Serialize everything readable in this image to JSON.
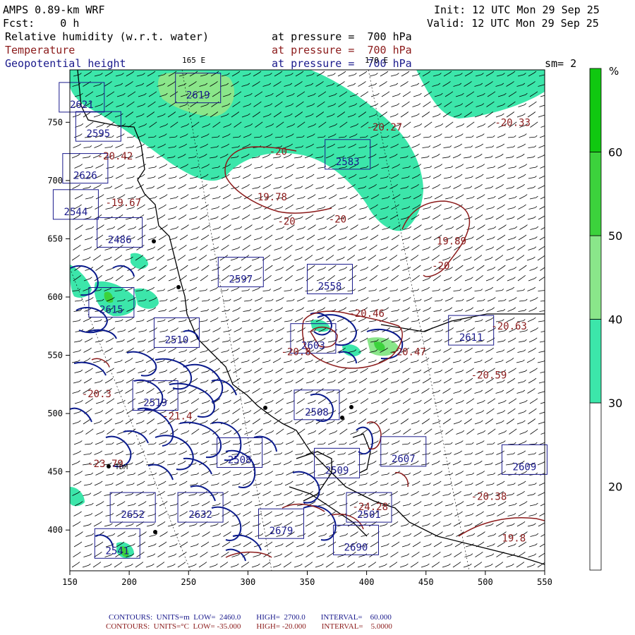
{
  "header": {
    "model": "AMPS 0.89-km WRF",
    "init": "Init: 12 UTC Mon 29 Sep 25",
    "fcst": "Fcst:    0 h",
    "valid": "Valid: 12 UTC Mon 29 Sep 25",
    "field1": "Relative humidity (w.r.t. water)",
    "field2": "Temperature",
    "field3": "Geopotential height",
    "pressure": "at pressure =  700 hPa",
    "lon_label1": "165 E",
    "lon_label2": "170 E",
    "sm": "sm= 2"
  },
  "map": {
    "x_range": [
      150,
      550
    ],
    "y_range": [
      365,
      795
    ],
    "x_ticks": [
      "150",
      "200",
      "250",
      "300",
      "350",
      "400",
      "450",
      "500",
      "550"
    ],
    "y_ticks": [
      "400",
      "450",
      "500",
      "550",
      "600",
      "650",
      "700",
      "750"
    ],
    "colorbar": {
      "unit": "%",
      "labels": [
        "20",
        "30",
        "40",
        "50",
        "60"
      ],
      "bands": [
        {
          "from": 10,
          "to": 30,
          "color": "#ffffff"
        },
        {
          "from": 30,
          "to": 40,
          "color": "#3ce6aa"
        },
        {
          "from": 40,
          "to": 50,
          "color": "#8ae68a"
        },
        {
          "from": 50,
          "to": 60,
          "color": "#3cd23c"
        },
        {
          "from": 60,
          "to": 70,
          "color": "#10c810"
        }
      ]
    },
    "height_labels": [
      {
        "t": "2619",
        "x": 258,
        "y": 774
      },
      {
        "t": "2595",
        "x": 174,
        "y": 741
      },
      {
        "t": "2583",
        "x": 384,
        "y": 717
      },
      {
        "t": "2626",
        "x": 163,
        "y": 705
      },
      {
        "t": "2486",
        "x": 192,
        "y": 650
      },
      {
        "t": "2597",
        "x": 294,
        "y": 616
      },
      {
        "t": "2558",
        "x": 369,
        "y": 610
      },
      {
        "t": "2615",
        "x": 185,
        "y": 590
      },
      {
        "t": "2510",
        "x": 240,
        "y": 564
      },
      {
        "t": "2603",
        "x": 355,
        "y": 559
      },
      {
        "t": "2611",
        "x": 488,
        "y": 566
      },
      {
        "t": "2519",
        "x": 222,
        "y": 510
      },
      {
        "t": "2508",
        "x": 358,
        "y": 502
      },
      {
        "t": "2508",
        "x": 293,
        "y": 461
      },
      {
        "t": "2509",
        "x": 375,
        "y": 452
      },
      {
        "t": "2607",
        "x": 431,
        "y": 462
      },
      {
        "t": "2609",
        "x": 533,
        "y": 455
      },
      {
        "t": "2652",
        "x": 203,
        "y": 414
      },
      {
        "t": "2632",
        "x": 260,
        "y": 414
      },
      {
        "t": "2679",
        "x": 328,
        "y": 400
      },
      {
        "t": "2501",
        "x": 402,
        "y": 414
      },
      {
        "t": "2690",
        "x": 391,
        "y": 386
      },
      {
        "t": "2541",
        "x": 190,
        "y": 383
      },
      {
        "t": "2544",
        "x": 155,
        "y": 674
      },
      {
        "t": "2621",
        "x": 160,
        "y": 766
      }
    ],
    "temp_labels": [
      {
        "t": "-20",
        "x": 318,
        "y": 722
      },
      {
        "t": "-20.42",
        "x": 173,
        "y": 718
      },
      {
        "t": "19.78",
        "x": 308,
        "y": 683
      },
      {
        "t": "-19.67",
        "x": 180,
        "y": 678
      },
      {
        "t": "-20",
        "x": 325,
        "y": 662
      },
      {
        "t": "-20",
        "x": 368,
        "y": 664
      },
      {
        "t": "-20.27",
        "x": 400,
        "y": 743
      },
      {
        "t": "-20.33",
        "x": 508,
        "y": 747
      },
      {
        "t": "19.89",
        "x": 459,
        "y": 645
      },
      {
        "t": "-20",
        "x": 455,
        "y": 624
      },
      {
        "t": "-20.46",
        "x": 385,
        "y": 583
      },
      {
        "t": "-20.63",
        "x": 505,
        "y": 572
      },
      {
        "t": "-20.8",
        "x": 328,
        "y": 550
      },
      {
        "t": "-20.47",
        "x": 420,
        "y": 550
      },
      {
        "t": "-20.59",
        "x": 488,
        "y": 530
      },
      {
        "t": "-20.3",
        "x": 160,
        "y": 514
      },
      {
        "t": "-21.4",
        "x": 228,
        "y": 495
      },
      {
        "t": "-20.38",
        "x": 488,
        "y": 426
      },
      {
        "t": "19.8",
        "x": 514,
        "y": 390
      },
      {
        "t": "-23.79",
        "x": 165,
        "y": 454
      },
      {
        "t": "-24.28",
        "x": 388,
        "y": 417
      }
    ],
    "station": "TDM"
  },
  "footer": {
    "line1": "CONTOURS:  UNITS=m  LOW=  2460.0        HIGH=  2700.0        INTERVAL=    60.000",
    "line2": "CONTOURS:  UNITS=°C  LOW= -35.000        HIGH= -20.000        INTERVAL=    5.0000"
  }
}
